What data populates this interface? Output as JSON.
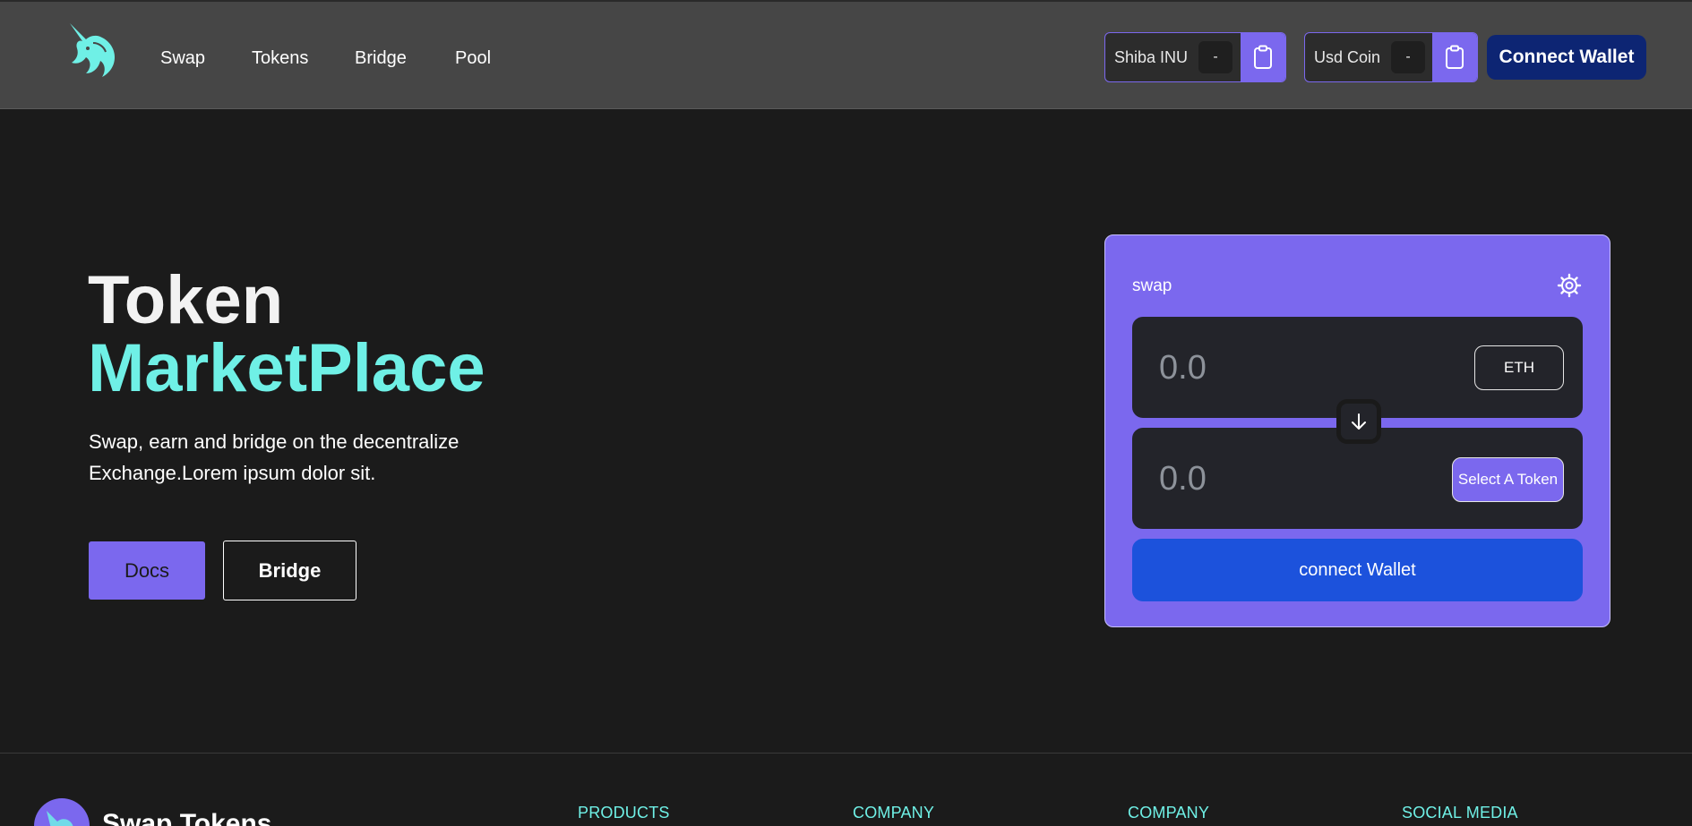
{
  "header": {
    "nav": [
      {
        "label": "Swap"
      },
      {
        "label": "Tokens"
      },
      {
        "label": "Bridge"
      },
      {
        "label": "Pool"
      }
    ],
    "tokens": [
      {
        "name": "Shiba INU",
        "value": "-"
      },
      {
        "name": "Usd Coin",
        "value": "-"
      }
    ],
    "connect_label": "Connect Wallet"
  },
  "hero": {
    "title_line1": "Token",
    "title_line2": "MarketPlace",
    "description": "Swap, earn and bridge on the decentralize Exchange.Lorem ipsum dolor sit.",
    "docs_label": "Docs",
    "bridge_label": "Bridge"
  },
  "swap": {
    "label": "swap",
    "from_placeholder": "0.0",
    "to_placeholder": "0.0",
    "from_token": "ETH",
    "to_token": "Select A Token",
    "connect_label": "connect Wallet"
  },
  "footer": {
    "brand": "Swap Tokens",
    "columns": [
      "PRODUCTS",
      "COMPANY",
      "COMPANY",
      "SOCIAL MEDIA"
    ]
  },
  "colors": {
    "accent": "#7b68ee",
    "cyan": "#6ff0e6",
    "navy": "#0d2573",
    "blue": "#1c52dc",
    "header_bg": "#464646",
    "page_bg": "#1b1b1b"
  },
  "icons": [
    "unicorn-logo-icon",
    "clipboard-icon",
    "gear-icon",
    "arrow-down-icon"
  ]
}
